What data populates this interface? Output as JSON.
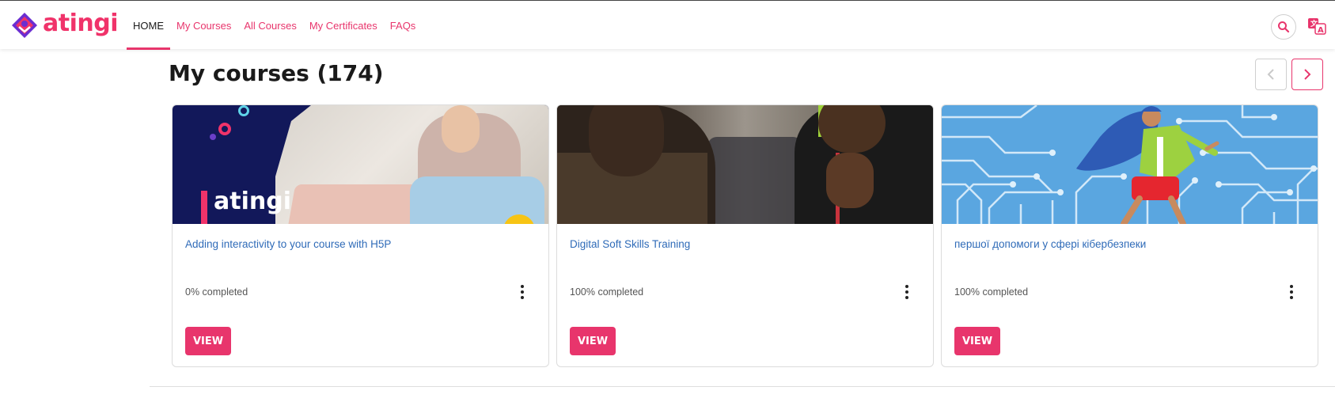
{
  "brand": {
    "name": "atingi"
  },
  "nav": {
    "items": [
      {
        "label": "HOME",
        "active": true
      },
      {
        "label": "My Courses",
        "active": false
      },
      {
        "label": "All Courses",
        "active": false
      },
      {
        "label": "My Certificates",
        "active": false
      },
      {
        "label": "FAQs",
        "active": false
      }
    ]
  },
  "header_icons": {
    "search": "search-icon",
    "language": "language-icon"
  },
  "main": {
    "title": "My courses (174)",
    "pager": {
      "prev": "chevron-left-icon",
      "next": "chevron-right-icon"
    },
    "courses": [
      {
        "title": "Adding interactivity to your course with H5P",
        "progress": "0% completed",
        "view_label": "VIEW",
        "image_text": "atingi"
      },
      {
        "title": "Digital Soft Skills Training",
        "progress": "100% completed",
        "view_label": "VIEW"
      },
      {
        "title": "першої допомоги у сфері кібербезпеки",
        "progress": "100% completed",
        "view_label": "VIEW"
      }
    ]
  },
  "colors": {
    "accent": "#e8356c",
    "link": "#2f6bb8",
    "brand_purple": "#6b2ed1"
  }
}
